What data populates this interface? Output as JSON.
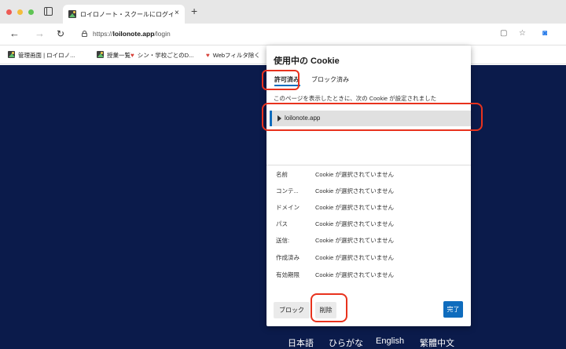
{
  "browser": {
    "tab": {
      "title": "ロイロノート・スクールにログイ",
      "close": "×"
    },
    "new_tab": "+",
    "nav": {
      "back": "←",
      "forward": "→",
      "reload": "↻"
    },
    "url": {
      "prefix": "https://",
      "host": "loilonote.app",
      "path": "/login"
    },
    "toolbar_icons": [
      "reader-mode-icon",
      "favorites-icon",
      "extension-icon"
    ],
    "bookmarks": [
      {
        "label": "管理画面 | ロイロノ...",
        "icon": "loilo-favicon"
      },
      {
        "label": "授業一覧",
        "icon": "loilo-favicon"
      },
      {
        "label": "シン・学校ごとのD...",
        "icon": "heart-favicon"
      },
      {
        "label": "Webフィルタ除く",
        "icon": "heart-favicon"
      }
    ]
  },
  "cookie_dialog": {
    "title": "使用中の Cookie",
    "tabs": [
      {
        "label": "許可済み",
        "active": true
      },
      {
        "label": "ブロック済み",
        "active": false
      }
    ],
    "description": "このページを表示したときに、次の Cookie が設定されました",
    "tree_item": "loilonote.app",
    "properties": [
      {
        "key": "名前",
        "value": "Cookie が選択されていません"
      },
      {
        "key": "コンテ...",
        "value": "Cookie が選択されていません"
      },
      {
        "key": "ドメイン",
        "value": "Cookie が選択されていません"
      },
      {
        "key": "パス",
        "value": "Cookie が選択されていません"
      },
      {
        "key": "送信:",
        "value": "Cookie が選択されていません"
      },
      {
        "key": "作成済み",
        "value": "Cookie が選択されていません"
      },
      {
        "key": "有効期限",
        "value": "Cookie が選択されていません"
      }
    ],
    "buttons": {
      "block": "ブロック",
      "delete": "削除",
      "done": "完了"
    }
  },
  "page": {
    "languages": [
      {
        "label": "日本語",
        "current": true
      },
      {
        "label": "ひらがな",
        "current": false
      },
      {
        "label": "English",
        "current": false
      },
      {
        "label": "繁體中文",
        "current": false
      }
    ]
  },
  "colors": {
    "page_background": "#0b1b4b",
    "accent": "#0f6cbd",
    "highlight": "#e8321d"
  }
}
